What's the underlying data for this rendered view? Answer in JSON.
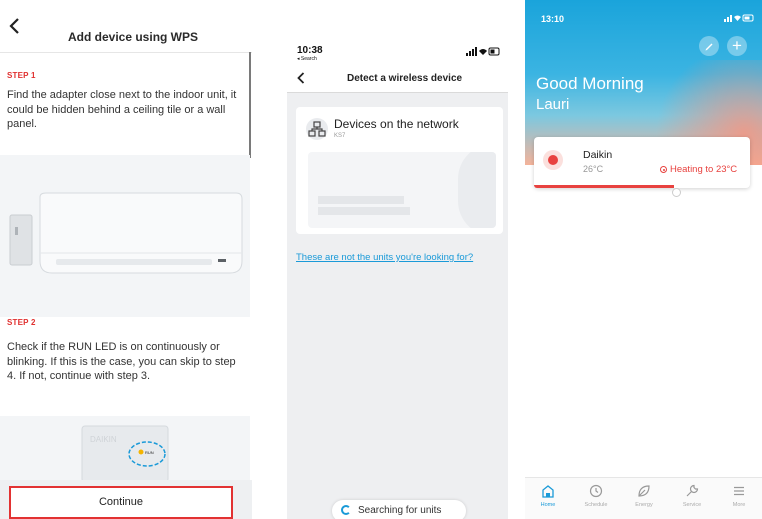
{
  "panel1": {
    "title": "Add device using WPS",
    "step1_label": "STEP 1",
    "step1_text": "Find the adapter close next to the indoor unit, it could be hidden behind a ceiling tile or a wall panel.",
    "step2_label": "STEP 2",
    "step2_text": "Check if the RUN LED is on continuously or blinking. If this is the case, you can skip to step 4. If not, continue with step 3.",
    "continue_label": "Continue",
    "run_led_label": "RUN"
  },
  "panel2": {
    "time": "10:38",
    "back_app": "◂ Search",
    "title": "Detect a wireless device",
    "devices_title": "Devices on the network",
    "devices_subtitle": "KS7",
    "link_text": "These are not the units you're looking for?",
    "searching_label": "Searching for units"
  },
  "panel3": {
    "time": "13:10",
    "greeting": "Good Morning",
    "user_name": "Lauri",
    "device_name": "Daikin",
    "device_temp": "26°C",
    "heating_status": "Heating to 23°C",
    "tabs": [
      {
        "label": "Home",
        "icon": "home-icon"
      },
      {
        "label": "Schedule",
        "icon": "clock-icon"
      },
      {
        "label": "Energy",
        "icon": "leaf-icon"
      },
      {
        "label": "Service",
        "icon": "wrench-icon"
      },
      {
        "label": "More",
        "icon": "menu-icon"
      }
    ]
  },
  "colors": {
    "accent_red": "#e23232",
    "link_blue": "#1a9ad8",
    "heating_red": "#e8423f"
  }
}
